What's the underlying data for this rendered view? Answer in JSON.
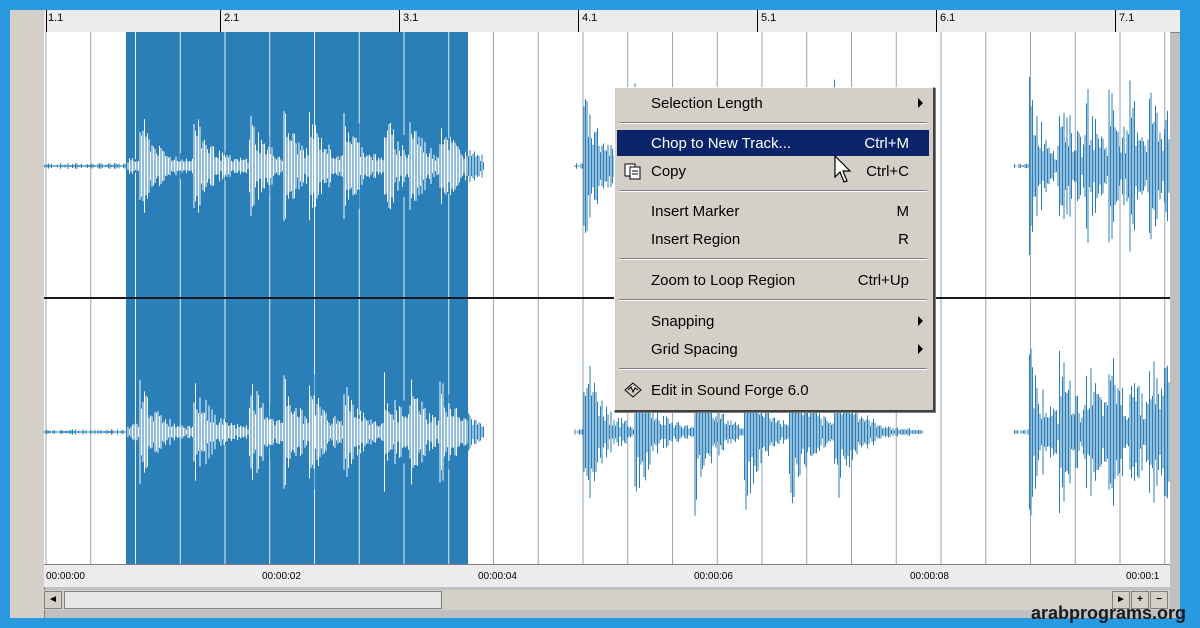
{
  "ruler_top": {
    "bars": [
      "1.1",
      "2.1",
      "3.1",
      "4.1",
      "5.1",
      "6.1",
      "7.1"
    ]
  },
  "ruler_bottom": {
    "times": [
      "00:00:00",
      "00:00:02",
      "00:00:04",
      "00:00:06",
      "00:00:08",
      "00:00:1"
    ]
  },
  "context_menu": {
    "items": [
      {
        "label": "Selection Length",
        "shortcut": "",
        "submenu": true
      },
      {
        "label": "Chop to New Track...",
        "shortcut": "Ctrl+M",
        "highlighted": true
      },
      {
        "label": "Copy",
        "shortcut": "Ctrl+C",
        "icon": "copy-icon"
      },
      {
        "label": "Insert Marker",
        "shortcut": "M"
      },
      {
        "label": "Insert Region",
        "shortcut": "R"
      },
      {
        "label": "Zoom to Loop Region",
        "shortcut": "Ctrl+Up"
      },
      {
        "label": "Snapping",
        "shortcut": "",
        "submenu": true
      },
      {
        "label": "Grid Spacing",
        "shortcut": "",
        "submenu": true
      },
      {
        "label": "Edit in Sound Forge 6.0",
        "shortcut": "",
        "icon": "sound-forge-icon"
      }
    ]
  },
  "scrollbar": {
    "left_arrow": "◄",
    "right_arrow": "►",
    "zoom_in": "+",
    "zoom_out": "−"
  },
  "watermark": "arabprograms.org",
  "colors": {
    "waveform": "#2a7fb8",
    "selection": "#2a7fb8",
    "menu_highlight": "#0a246a",
    "background_border": "#2a9ae0"
  }
}
